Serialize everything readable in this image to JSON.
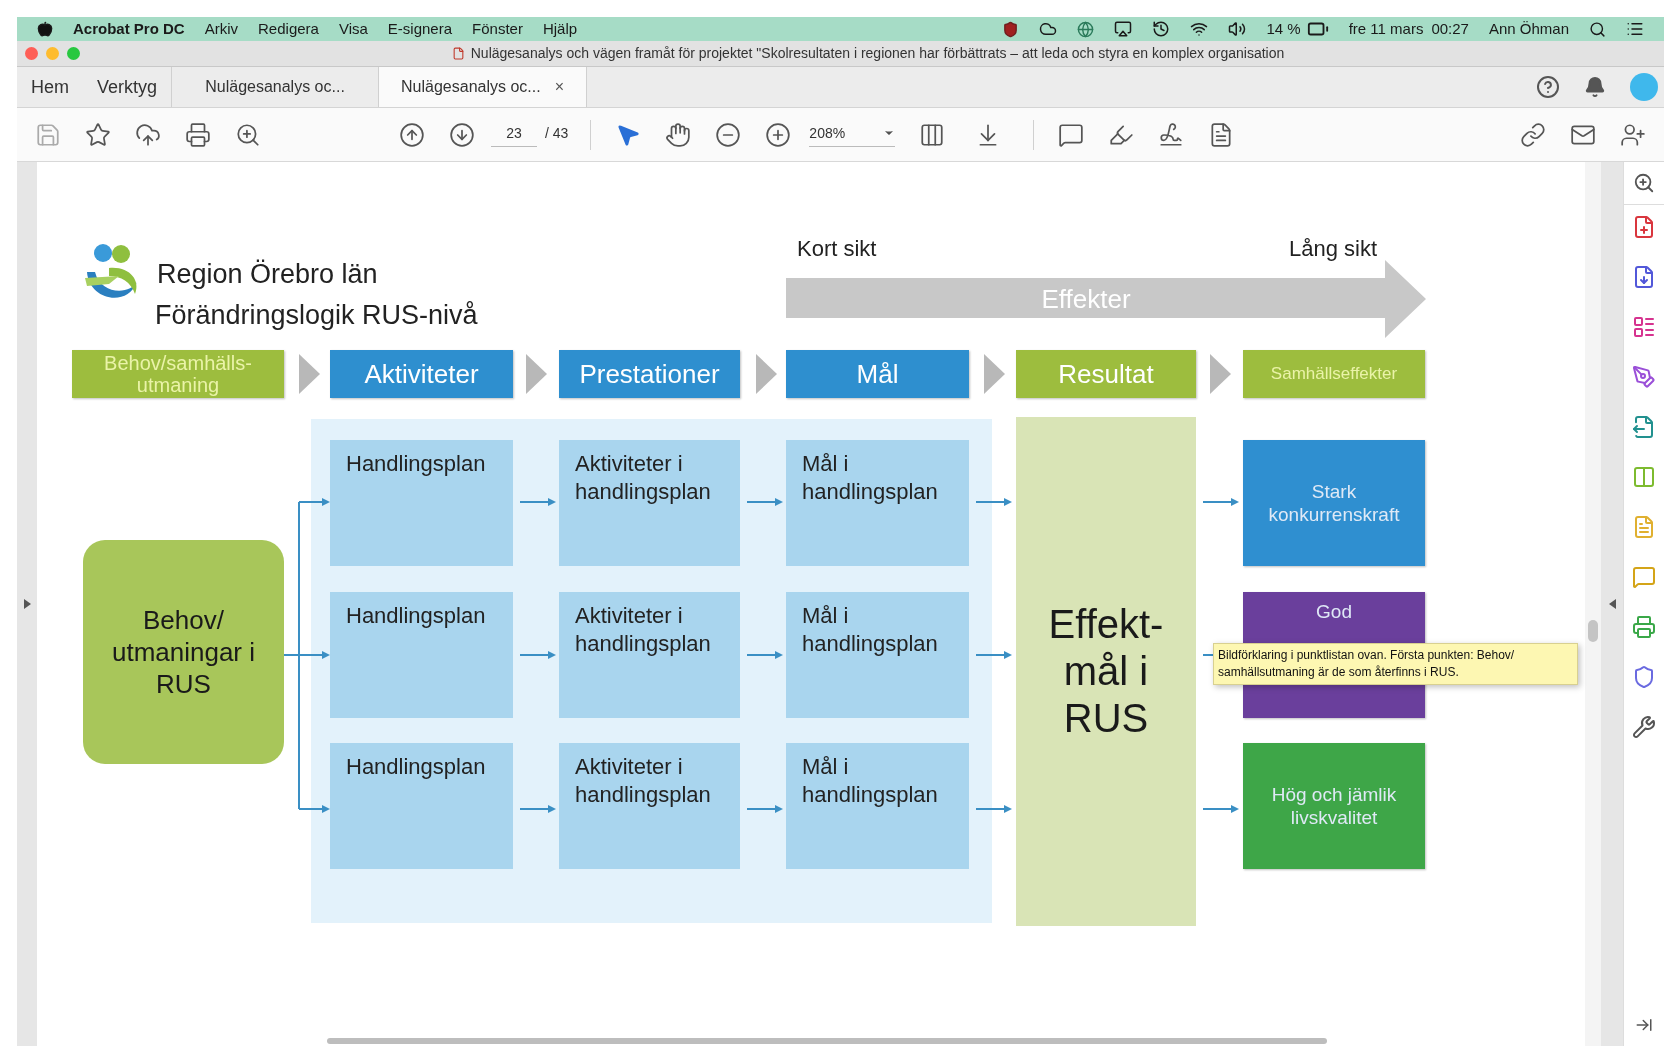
{
  "menubar": {
    "app_name": "Acrobat Pro DC",
    "items": [
      "Arkiv",
      "Redigera",
      "Visa",
      "E-signera",
      "Fönster",
      "Hjälp"
    ],
    "battery": "14 %",
    "date": "fre 11 mars",
    "time": "00:27",
    "user": "Ann Öhman"
  },
  "title_bar": {
    "title": "Nulägesanalys och vägen framåt för projektet \"Skolresultaten i regionen har förbättrats – att leda och styra en komplex organisation"
  },
  "tabs": [
    {
      "kind": "nav",
      "label": "Hem",
      "selected": false
    },
    {
      "kind": "nav",
      "label": "Verktyg",
      "selected": false
    },
    {
      "kind": "document",
      "label": "Nulägesanalys oc...",
      "selected": false
    },
    {
      "kind": "document",
      "label": "Nulägesanalys oc...",
      "selected": true,
      "close": "×"
    }
  ],
  "toolbar": {
    "page_current": "23",
    "page_total": "/ 43",
    "zoom": "208%"
  },
  "diagram": {
    "org": "Region Örebro län",
    "title": "Förändringslogik RUS-nivå",
    "short_term": "Kort sikt",
    "long_term": "Lång sikt",
    "band": "Effekter",
    "headers": [
      {
        "label": "Behov/samhälls-utmaning",
        "color": "#9dbd3e",
        "kind": "small"
      },
      {
        "label": "Aktiviteter",
        "color": "#2e8fcf",
        "kind": "large"
      },
      {
        "label": "Prestationer",
        "color": "#2e8fcf",
        "kind": "large"
      },
      {
        "label": "Mål",
        "color": "#2e8fcf",
        "kind": "large"
      },
      {
        "label": "Resultat",
        "color": "#9dbd3e",
        "kind": "large"
      },
      {
        "label": "Samhällseffekter",
        "color": "#9dbd3e",
        "kind": "tiny"
      }
    ],
    "need": "Behov/ utmaningar i RUS",
    "rows": [
      {
        "cells": [
          "Handlingsplan",
          "Aktiviteter i handlingsplan",
          "Mål i handlingsplan"
        ]
      },
      {
        "cells": [
          "Handlingsplan",
          "Aktiviteter i handlingsplan",
          "Mål i handlingsplan"
        ]
      },
      {
        "cells": [
          "Handlingsplan",
          "Aktiviteter i handlingsplan",
          "Mål i handlingsplan"
        ]
      }
    ],
    "result": "Effekt- mål i RUS",
    "effects": [
      {
        "label": "Stark konkurrenskraft",
        "color": "#2f8fd0"
      },
      {
        "label": "God",
        "color": "#6a3f9c"
      },
      {
        "label": "Hög och jämlik livskvalitet",
        "color": "#3ea648"
      }
    ]
  },
  "tooltip": "Bildförklaring i punktlistan ovan. Första punkten: Behov/ samhällsutmaning är de som återfinns i RUS."
}
